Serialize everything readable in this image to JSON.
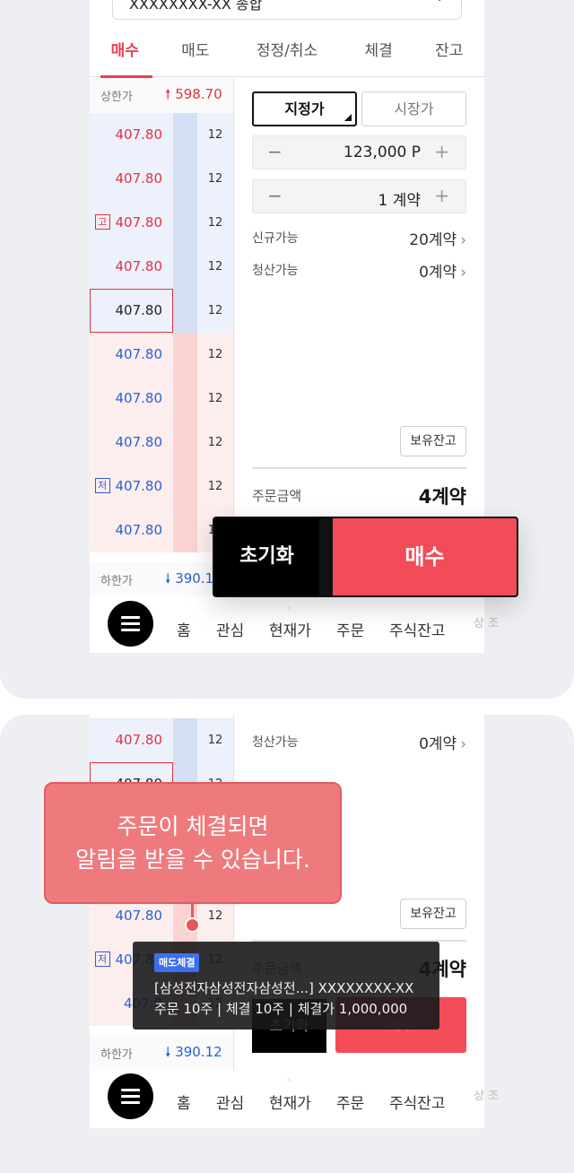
{
  "account": {
    "label": "XXXXXXXX-XX 종합"
  },
  "tabs": [
    "매수",
    "매도",
    "정정/취소",
    "체결",
    "잔고"
  ],
  "book": {
    "upper_limit_label": "상한가",
    "upper_limit_value": "598.70",
    "lower_limit_label": "하한가",
    "lower_limit_value": "390.12",
    "lower_limit_value_cut": "390.1",
    "rows": [
      {
        "price": "407.80",
        "qty": "12",
        "side": "ask",
        "tag": ""
      },
      {
        "price": "407.80",
        "qty": "12",
        "side": "ask",
        "tag": ""
      },
      {
        "price": "407.80",
        "qty": "12",
        "side": "ask",
        "tag": "고"
      },
      {
        "price": "407.80",
        "qty": "12",
        "side": "ask",
        "tag": ""
      },
      {
        "price": "407.80",
        "qty": "12",
        "side": "ask",
        "tag": "",
        "current": true
      },
      {
        "price": "407.80",
        "qty": "12",
        "side": "bid",
        "tag": ""
      },
      {
        "price": "407.80",
        "qty": "12",
        "side": "bid",
        "tag": ""
      },
      {
        "price": "407.80",
        "qty": "12",
        "side": "bid",
        "tag": ""
      },
      {
        "price": "407.80",
        "qty": "12",
        "side": "bid",
        "tag": "저"
      },
      {
        "price": "407.80",
        "qty": "12",
        "side": "bid",
        "tag": ""
      }
    ]
  },
  "order": {
    "type_limit": "지정가",
    "type_market": "시장가",
    "price": "123,000 P",
    "quantity": "1 계약",
    "new_available_label": "신규가능",
    "new_available_value": "20계약",
    "close_available_label": "청산가능",
    "close_available_value": "0계약",
    "holdings_button": "보유잔고",
    "amount_label": "주문금액",
    "amount_value": "4계약",
    "reset_button": "초기화",
    "buy_button": "매수"
  },
  "nav": {
    "items": [
      "홈",
      "관심",
      "현재가",
      "주문",
      "주식잔고"
    ],
    "more": "상 조"
  },
  "tooltip": {
    "line1": "주문이 체결되면",
    "line2": "알림을 받을 수 있습니다."
  },
  "toast": {
    "badge": "매도체결",
    "line1": "[삼성전자삼성전자삼성전...] XXXXXXXX-XX",
    "line2": "주문 10주 | 체결 10주 | 체결가 1,000,000"
  },
  "card2_book_top": {
    "row1_price": "407.80",
    "row1_qty": "12",
    "row2_price": "407.80",
    "row2_qty": "12",
    "row3_price": "407.80",
    "row3_qty": "12",
    "row4_price": "407.80",
    "row4_qty": "12",
    "row5_price": "407.8",
    "row5_qty": "12"
  },
  "colors": {
    "accent_red": "#e8414f",
    "buy_red": "#f14c58",
    "ask_blue": "#2c5fd6"
  }
}
